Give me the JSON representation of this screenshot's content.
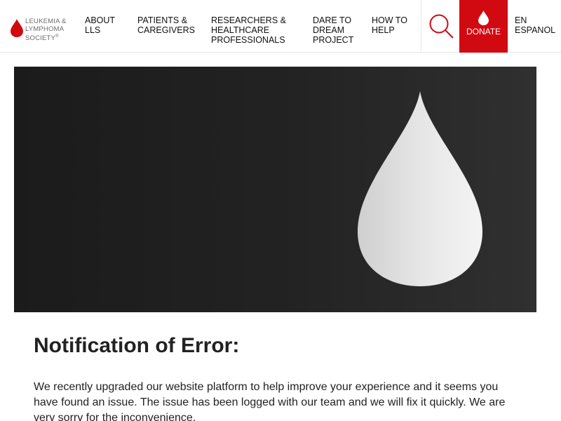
{
  "brand": {
    "logo_lines": [
      "LEUKEMIA &",
      "LYMPHOMA",
      "SOCIETY"
    ],
    "logo_mark": "®",
    "accent_color": "#d10a11",
    "logo_icon": "blood-drop-icon"
  },
  "nav": {
    "items": [
      {
        "label": "ABOUT LLS"
      },
      {
        "label": "PATIENTS & CAREGIVERS"
      },
      {
        "label": "RESEARCHERS & HEALTHCARE PROFESSIONALS"
      },
      {
        "label": "DARE TO DREAM PROJECT"
      },
      {
        "label": "HOW TO HELP"
      }
    ],
    "search_icon": "search-icon",
    "donate": {
      "label": "DONATE",
      "icon": "blood-drop-icon",
      "background": "#d10a11"
    },
    "language": {
      "label": "EN ESPANOL"
    }
  },
  "hero": {
    "icon": "blood-drop-icon",
    "background": "#1f1f1f"
  },
  "content": {
    "title": "Notification of Error:",
    "body": "We recently upgraded our website platform to help improve your experience and it seems you have found an issue. The issue has been logged with our team and we will fix it quickly. We are very sorry for the inconvenience."
  }
}
